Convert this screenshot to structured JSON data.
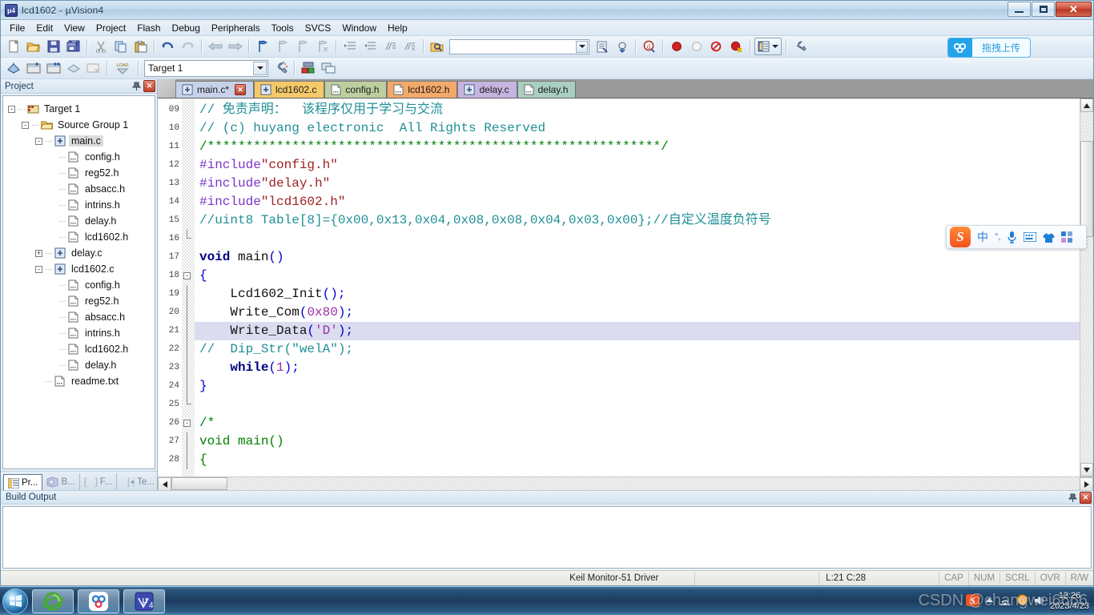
{
  "window": {
    "title": "lcd1602  - µVision4",
    "icon": "uvision-logo-icon",
    "minimize": "",
    "maximize": "",
    "close": "✕"
  },
  "menubar": {
    "items": [
      {
        "label": "File"
      },
      {
        "label": "Edit"
      },
      {
        "label": "View"
      },
      {
        "label": "Project"
      },
      {
        "label": "Flash"
      },
      {
        "label": "Debug"
      },
      {
        "label": "Peripherals"
      },
      {
        "label": "Tools"
      },
      {
        "label": "SVCS"
      },
      {
        "label": "Window"
      },
      {
        "label": "Help"
      }
    ]
  },
  "toolbar2": {
    "target_value": "Target 1",
    "search_value": ""
  },
  "baidu_upload": {
    "label": "拖拽上传"
  },
  "project_panel": {
    "title": "Project",
    "pin": "⊼",
    "close": "✕",
    "tree": [
      {
        "indent": 0,
        "expander": "-",
        "icon": "target-icon",
        "label": "Target 1",
        "selected": false
      },
      {
        "indent": 1,
        "expander": "-",
        "icon": "folder-icon",
        "label": "Source Group 1",
        "selected": false
      },
      {
        "indent": 2,
        "expander": "-",
        "icon": "c-source-icon",
        "label": "main.c",
        "selected": true
      },
      {
        "indent": 3,
        "expander": "",
        "icon": "header-file-icon",
        "label": "config.h",
        "selected": false
      },
      {
        "indent": 3,
        "expander": "",
        "icon": "header-file-icon",
        "label": "reg52.h",
        "selected": false
      },
      {
        "indent": 3,
        "expander": "",
        "icon": "header-file-icon",
        "label": "absacc.h",
        "selected": false
      },
      {
        "indent": 3,
        "expander": "",
        "icon": "header-file-icon",
        "label": "intrins.h",
        "selected": false
      },
      {
        "indent": 3,
        "expander": "",
        "icon": "header-file-icon",
        "label": "delay.h",
        "selected": false
      },
      {
        "indent": 3,
        "expander": "",
        "icon": "header-file-icon",
        "label": "lcd1602.h",
        "selected": false
      },
      {
        "indent": 2,
        "expander": "+",
        "icon": "c-source-icon",
        "label": "delay.c",
        "selected": false
      },
      {
        "indent": 2,
        "expander": "-",
        "icon": "c-source-icon",
        "label": "lcd1602.c",
        "selected": false
      },
      {
        "indent": 3,
        "expander": "",
        "icon": "header-file-icon",
        "label": "config.h",
        "selected": false
      },
      {
        "indent": 3,
        "expander": "",
        "icon": "header-file-icon",
        "label": "reg52.h",
        "selected": false
      },
      {
        "indent": 3,
        "expander": "",
        "icon": "header-file-icon",
        "label": "absacc.h",
        "selected": false
      },
      {
        "indent": 3,
        "expander": "",
        "icon": "header-file-icon",
        "label": "intrins.h",
        "selected": false
      },
      {
        "indent": 3,
        "expander": "",
        "icon": "header-file-icon",
        "label": "lcd1602.h",
        "selected": false
      },
      {
        "indent": 3,
        "expander": "",
        "icon": "header-file-icon",
        "label": "delay.h",
        "selected": false
      },
      {
        "indent": 2,
        "expander": "",
        "icon": "text-file-icon",
        "label": "readme.txt",
        "selected": false
      }
    ],
    "tabs": [
      {
        "label": "Pr...",
        "icon": "project-icon",
        "active": true
      },
      {
        "label": "B...",
        "icon": "books-icon",
        "active": false
      },
      {
        "label": "F...",
        "icon": "functions-icon",
        "active": false
      },
      {
        "label": "Te...",
        "icon": "templates-icon",
        "active": false
      }
    ]
  },
  "editor": {
    "tabs": [
      {
        "label": "main.c*",
        "color": "#c7d2ea",
        "active": true,
        "closable": true
      },
      {
        "label": "lcd1602.c",
        "color": "#f5c96a",
        "active": false,
        "closable": false
      },
      {
        "label": "config.h",
        "color": "#bdcf9f",
        "active": false,
        "closable": false
      },
      {
        "label": "lcd1602.h",
        "color": "#f3a96a",
        "active": false,
        "closable": false
      },
      {
        "label": "delay.c",
        "color": "#c6b4e0",
        "active": false,
        "closable": false
      },
      {
        "label": "delay.h",
        "color": "#a9cfc0",
        "active": false,
        "closable": false
      }
    ],
    "first_line": 9,
    "highlight_line": 21,
    "lines": [
      {
        "n": "09",
        "fold": "",
        "tokens": [
          {
            "t": "// 免责声明：  该程序仅用于学习与交流",
            "c": "cmt"
          }
        ]
      },
      {
        "n": "10",
        "fold": "",
        "tokens": [
          {
            "t": "// (c) huyang electronic  All Rights Reserved",
            "c": "cmt"
          }
        ]
      },
      {
        "n": "11",
        "fold": "",
        "tokens": [
          {
            "t": "/",
            "c": "cmt2"
          },
          {
            "t": "***********************************************************",
            "c": "cmt2"
          },
          {
            "t": "/",
            "c": "cmt2"
          }
        ]
      },
      {
        "n": "12",
        "fold": "",
        "tokens": [
          {
            "t": "#include",
            "c": "pre"
          },
          {
            "t": "\"config.h\"",
            "c": "str"
          }
        ]
      },
      {
        "n": "13",
        "fold": "",
        "tokens": [
          {
            "t": "#include",
            "c": "pre"
          },
          {
            "t": "\"delay.h\"",
            "c": "str"
          }
        ]
      },
      {
        "n": "14",
        "fold": "",
        "tokens": [
          {
            "t": "#include",
            "c": "pre"
          },
          {
            "t": "\"lcd1602.h\"",
            "c": "str"
          }
        ]
      },
      {
        "n": "15",
        "fold": "",
        "tokens": [
          {
            "t": "//uint8 Table[8]={0x00,0x13,0x04,0x08,0x08,0x04,0x03,0x00};//自定义温度负符号",
            "c": "cmt"
          }
        ]
      },
      {
        "n": "16",
        "fold": "end",
        "tokens": [
          {
            "t": "",
            "c": "pln"
          }
        ]
      },
      {
        "n": "17",
        "fold": "",
        "tokens": [
          {
            "t": "void ",
            "c": "kw"
          },
          {
            "t": "main",
            "c": "pln"
          },
          {
            "t": "()",
            "c": "punc"
          }
        ]
      },
      {
        "n": "18",
        "fold": "minus",
        "tokens": [
          {
            "t": "{",
            "c": "punc"
          }
        ]
      },
      {
        "n": "19",
        "fold": "bar",
        "tokens": [
          {
            "t": "    Lcd1602_Init",
            "c": "pln"
          },
          {
            "t": "();",
            "c": "punc"
          }
        ]
      },
      {
        "n": "20",
        "fold": "bar",
        "tokens": [
          {
            "t": "    Write_Com",
            "c": "pln"
          },
          {
            "t": "(",
            "c": "punc"
          },
          {
            "t": "0x80",
            "c": "num"
          },
          {
            "t": ");",
            "c": "punc"
          }
        ]
      },
      {
        "n": "21",
        "fold": "bar",
        "tokens": [
          {
            "t": "    Write_Data",
            "c": "pln"
          },
          {
            "t": "(",
            "c": "punc"
          },
          {
            "t": "'D'",
            "c": "num"
          },
          {
            "t": ");",
            "c": "punc"
          }
        ]
      },
      {
        "n": "22",
        "fold": "bar",
        "tokens": [
          {
            "t": "//  Dip_Str(\"welA\");",
            "c": "cmt"
          }
        ]
      },
      {
        "n": "23",
        "fold": "bar",
        "tokens": [
          {
            "t": "    while",
            "c": "kw"
          },
          {
            "t": "(",
            "c": "punc"
          },
          {
            "t": "1",
            "c": "num"
          },
          {
            "t": ");",
            "c": "punc"
          }
        ]
      },
      {
        "n": "24",
        "fold": "bar",
        "tokens": [
          {
            "t": "}",
            "c": "punc"
          }
        ]
      },
      {
        "n": "25",
        "fold": "end",
        "tokens": [
          {
            "t": "",
            "c": "pln"
          }
        ]
      },
      {
        "n": "26",
        "fold": "minus",
        "tokens": [
          {
            "t": "/*",
            "c": "cmt2"
          }
        ]
      },
      {
        "n": "27",
        "fold": "bar",
        "tokens": [
          {
            "t": "void main()",
            "c": "cmt2"
          }
        ]
      },
      {
        "n": "28",
        "fold": "bar",
        "tokens": [
          {
            "t": "{",
            "c": "cmt2"
          }
        ]
      }
    ]
  },
  "build_output": {
    "title": "Build Output",
    "pin": "⊼",
    "close": "✕",
    "content": ""
  },
  "statusbar": {
    "left": "",
    "driver": "Keil Monitor-51 Driver",
    "middle": "",
    "position": "L:21 C:28",
    "indicators": [
      "CAP",
      "NUM",
      "SCRL",
      "OVR",
      "R/W"
    ]
  },
  "ime": {
    "logo": "S",
    "items": [
      {
        "icon": "chinese-mode-icon",
        "glyph": "中"
      },
      {
        "icon": "punctuation-icon",
        "glyph": "°,"
      },
      {
        "icon": "voice-input-icon",
        "glyph": "🎤"
      },
      {
        "icon": "soft-keyboard-icon",
        "glyph": "⌨"
      },
      {
        "icon": "skin-icon",
        "glyph": "👕"
      },
      {
        "icon": "toolbox-icon",
        "glyph": "▪▪"
      }
    ]
  },
  "taskbar": {
    "start": "start-orb-icon",
    "tasks": [
      {
        "icon": "internet-explorer-icon",
        "label": "e"
      },
      {
        "icon": "baidu-netdisk-icon",
        "label": "∞"
      },
      {
        "icon": "uvision4-icon",
        "label": "µ4"
      }
    ],
    "tray": [
      {
        "icon": "sogou-tray-icon",
        "glyph": "S"
      },
      {
        "icon": "show-hidden-icon",
        "glyph": "▲"
      },
      {
        "icon": "network-icon",
        "glyph": "◖"
      },
      {
        "icon": "mail-icon",
        "glyph": "@"
      },
      {
        "icon": "volume-icon",
        "glyph": "◣"
      }
    ],
    "time": "12:26",
    "date": "2023/4/23"
  },
  "watermark": {
    "text": "CSDN @changwei6666"
  },
  "colors": {
    "accent": "#23a3ea",
    "comment": "#1f8f96",
    "keyword": "#000080",
    "string": "#a02020",
    "preproc": "#7a34c9",
    "number": "#9b2fa6"
  }
}
